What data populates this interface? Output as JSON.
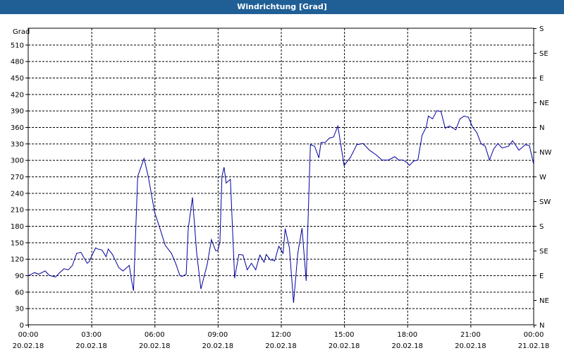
{
  "window": {
    "title": "Windrichtung [Grad]"
  },
  "colors": {
    "titlebar": "#1f5f96",
    "line": "#0000a0",
    "grid": "#000000",
    "background": "#ffffff"
  },
  "chart_data": {
    "type": "line",
    "title": "Windrichtung [Grad]",
    "ylabel": "Grad",
    "ylim": [
      0,
      540
    ],
    "yticks": [
      0,
      30,
      60,
      90,
      120,
      150,
      180,
      210,
      240,
      270,
      300,
      330,
      360,
      390,
      420,
      450,
      480,
      510
    ],
    "right_axis_labels": [
      {
        "value": 0,
        "label": "N"
      },
      {
        "value": 45,
        "label": "NE"
      },
      {
        "value": 90,
        "label": "E"
      },
      {
        "value": 135,
        "label": "SE"
      },
      {
        "value": 180,
        "label": "S"
      },
      {
        "value": 225,
        "label": "SW"
      },
      {
        "value": 270,
        "label": "W"
      },
      {
        "value": 315,
        "label": "NW"
      },
      {
        "value": 360,
        "label": "N"
      },
      {
        "value": 405,
        "label": "NE"
      },
      {
        "value": 450,
        "label": "E"
      },
      {
        "value": 495,
        "label": "SE"
      },
      {
        "value": 540,
        "label": "S"
      }
    ],
    "xlim": [
      "2018-02-20T00:00",
      "2018-02-21T00:00"
    ],
    "xticks": [
      {
        "hours": 0,
        "time": "00:00",
        "date": "20.02.18"
      },
      {
        "hours": 3,
        "time": "03:00",
        "date": "20.02.18"
      },
      {
        "hours": 6,
        "time": "06:00",
        "date": "20.02.18"
      },
      {
        "hours": 9,
        "time": "09:00",
        "date": "20.02.18"
      },
      {
        "hours": 12,
        "time": "12:00",
        "date": "20.02.18"
      },
      {
        "hours": 15,
        "time": "15:00",
        "date": "20.02.18"
      },
      {
        "hours": 18,
        "time": "18:00",
        "date": "20.02.18"
      },
      {
        "hours": 21,
        "time": "21:00",
        "date": "20.02.18"
      },
      {
        "hours": 24,
        "time": "00:00",
        "date": "21.02.18"
      }
    ],
    "grid": true,
    "series": [
      {
        "name": "",
        "hours": [
          0,
          0.3,
          0.5,
          0.8,
          1.0,
          1.3,
          1.5,
          1.7,
          1.9,
          2.1,
          2.3,
          2.5,
          2.8,
          2.9,
          3.0,
          3.2,
          3.3,
          3.5,
          3.7,
          3.8,
          4.0,
          4.3,
          4.5,
          4.8,
          4.9,
          5.0,
          5.2,
          5.5,
          5.7,
          6.0,
          6.3,
          6.5,
          6.8,
          7.0,
          7.2,
          7.3,
          7.5,
          7.6,
          7.8,
          8.0,
          8.2,
          8.5,
          8.7,
          8.9,
          9.0,
          9.1,
          9.2,
          9.3,
          9.4,
          9.6,
          9.8,
          10.0,
          10.2,
          10.4,
          10.6,
          10.8,
          11.0,
          11.2,
          11.3,
          11.5,
          11.6,
          11.7,
          11.9,
          12.1,
          12.2,
          12.4,
          12.6,
          12.8,
          13.0,
          13.2,
          13.4,
          13.6,
          13.8,
          13.9,
          14.1,
          14.3,
          14.5,
          14.7,
          15.0,
          15.3,
          15.6,
          15.9,
          16.2,
          16.5,
          16.8,
          17.1,
          17.4,
          17.6,
          17.8,
          18.0,
          18.1,
          18.3,
          18.5,
          18.7,
          18.9,
          19.0,
          19.2,
          19.4,
          19.6,
          19.8,
          20.0,
          20.3,
          20.5,
          20.7,
          20.9,
          21.1,
          21.3,
          21.5,
          21.7,
          21.9,
          22.1,
          22.3,
          22.5,
          22.8,
          23.0,
          23.3,
          23.6,
          23.8,
          24.0
        ],
        "values": [
          89,
          95,
          92,
          98,
          90,
          87,
          95,
          102,
          100,
          108,
          130,
          132,
          112,
          115,
          124,
          140,
          138,
          136,
          124,
          138,
          128,
          104,
          98,
          108,
          82,
          62,
          270,
          303,
          270,
          205,
          170,
          145,
          130,
          112,
          90,
          88,
          92,
          175,
          232,
          130,
          65,
          110,
          155,
          135,
          135,
          150,
          270,
          287,
          258,
          265,
          85,
          128,
          127,
          100,
          112,
          100,
          127,
          114,
          128,
          118,
          118,
          116,
          143,
          130,
          175,
          140,
          40,
          130,
          176,
          80,
          328,
          325,
          304,
          332,
          332,
          340,
          342,
          362,
          290,
          305,
          328,
          330,
          318,
          310,
          300,
          300,
          306,
          300,
          300,
          295,
          290,
          298,
          300,
          345,
          360,
          380,
          375,
          390,
          388,
          358,
          362,
          355,
          375,
          380,
          378,
          360,
          350,
          330,
          325,
          300,
          320,
          330,
          322,
          325,
          335,
          318,
          328,
          326,
          292,
          294,
          300,
          314,
          298,
          295,
          300
        ]
      }
    ]
  }
}
